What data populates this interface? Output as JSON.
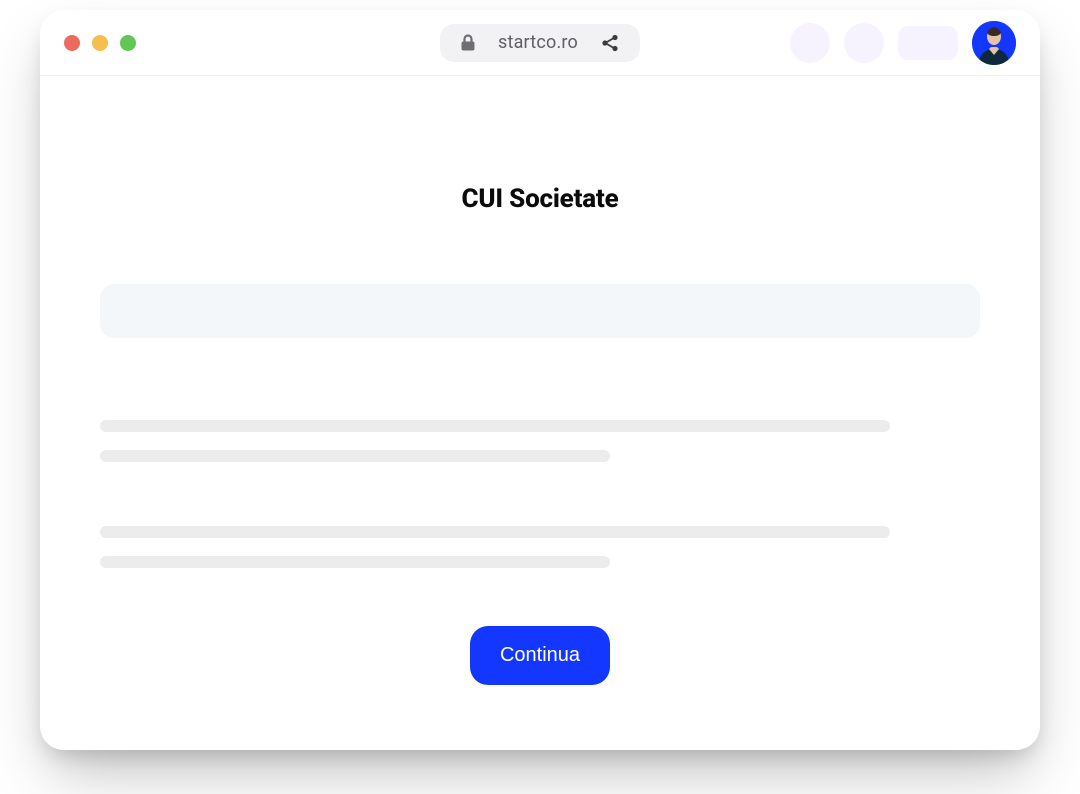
{
  "browser": {
    "url": "startco.ro"
  },
  "main": {
    "title": "CUI Societate",
    "input_value": "",
    "cta_label": "Continua"
  },
  "icons": {
    "lock": "lock-icon",
    "share": "share-icon"
  },
  "colors": {
    "accent": "#1337ff",
    "skeleton": "#ececec",
    "input_bg": "#f4f7f9"
  }
}
